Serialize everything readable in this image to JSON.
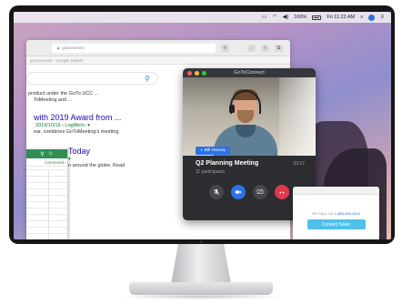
{
  "menubar": {
    "battery": "100%",
    "clock": "Fri 11:22 AM"
  },
  "browser": {
    "address": "gotoconnect",
    "tab_text": "gotoconnect - Google Search",
    "results": {
      "snippet_line1": "product under the GoTo UCC ...",
      "snippet_line2": "ToMeeting and ...",
      "title2": "with 2019 Award from ...",
      "url2": "2019/10/16 › LogMeIn- ▾",
      "snippet2": "ear, combines GoToMeeting's meeting",
      "title3": "Today",
      "url3": "▾",
      "snippet3": "n around the globe. Read"
    }
  },
  "calendar": {
    "comments_label": "Comments"
  },
  "call": {
    "window_title": "GoToConnect",
    "speaker_name": "Bill Harvey",
    "meeting_name": "Q2 Planning Meeting",
    "participants": "11 participants",
    "duration": "03:17",
    "icons": {
      "mute": "mic-off-icon",
      "camera": "video-camera-icon",
      "share": "screen-share-icon",
      "end": "end-call-icon"
    },
    "colors": {
      "badge": "#2b72e6",
      "end": "#e0384b",
      "background": "#2b2d31"
    }
  },
  "contact_panel": {
    "call_text": "OR CALL US",
    "phone": "1-888-646-0014",
    "button_label": "Contact Sales"
  }
}
